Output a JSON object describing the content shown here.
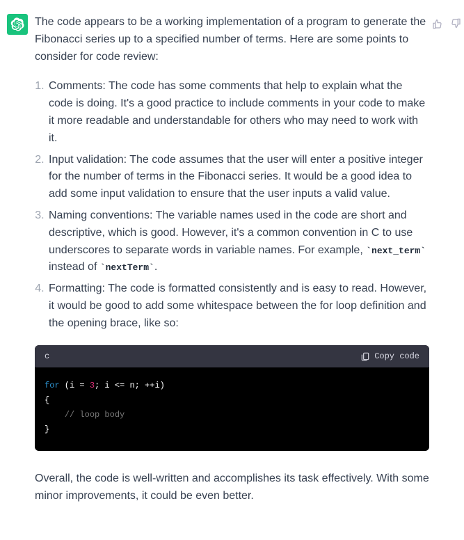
{
  "avatar_icon": "chatgpt-logo",
  "intro": "The code appears to be a working implementation of a program to generate the Fibonacci series up to a specified number of terms. Here are some points to consider for code review:",
  "points": [
    {
      "text": "Comments: The code has some comments that help to explain what the code is doing. It's a good practice to include comments in your code to make it more readable and understandable for others who may need to work with it."
    },
    {
      "text": "Input validation: The code assumes that the user will enter a positive integer for the number of terms in the Fibonacci series. It would be a good idea to add some input validation to ensure that the user inputs a valid value."
    },
    {
      "prefix": "Naming conventions: The variable names used in the code are short and descriptive, which is good. However, it's a common convention in C to use underscores to separate words in variable names. For example, ",
      "code1": "`next_term`",
      "mid": " instead of ",
      "code2": "`nextTerm`",
      "suffix": "."
    },
    {
      "text": "Formatting: The code is formatted consistently and is easy to read. However, it would be good to add some whitespace between the for loop definition and the opening brace, like so:"
    }
  ],
  "code": {
    "language": "c",
    "copy_label": "Copy code",
    "tokens": {
      "kw_for": "for",
      "num_3": "3",
      "line1_a": " (i = ",
      "line1_b": "; i <= n; ++i)",
      "line2": "{",
      "line3_indent": "    ",
      "line3_comment": "// loop body",
      "line4": "}"
    }
  },
  "outro": "Overall, the code is well-written and accomplishes its task effectively. With some minor improvements, it could be even better.",
  "feedback": {
    "like_icon": "thumbs-up-icon",
    "dislike_icon": "thumbs-down-icon"
  }
}
